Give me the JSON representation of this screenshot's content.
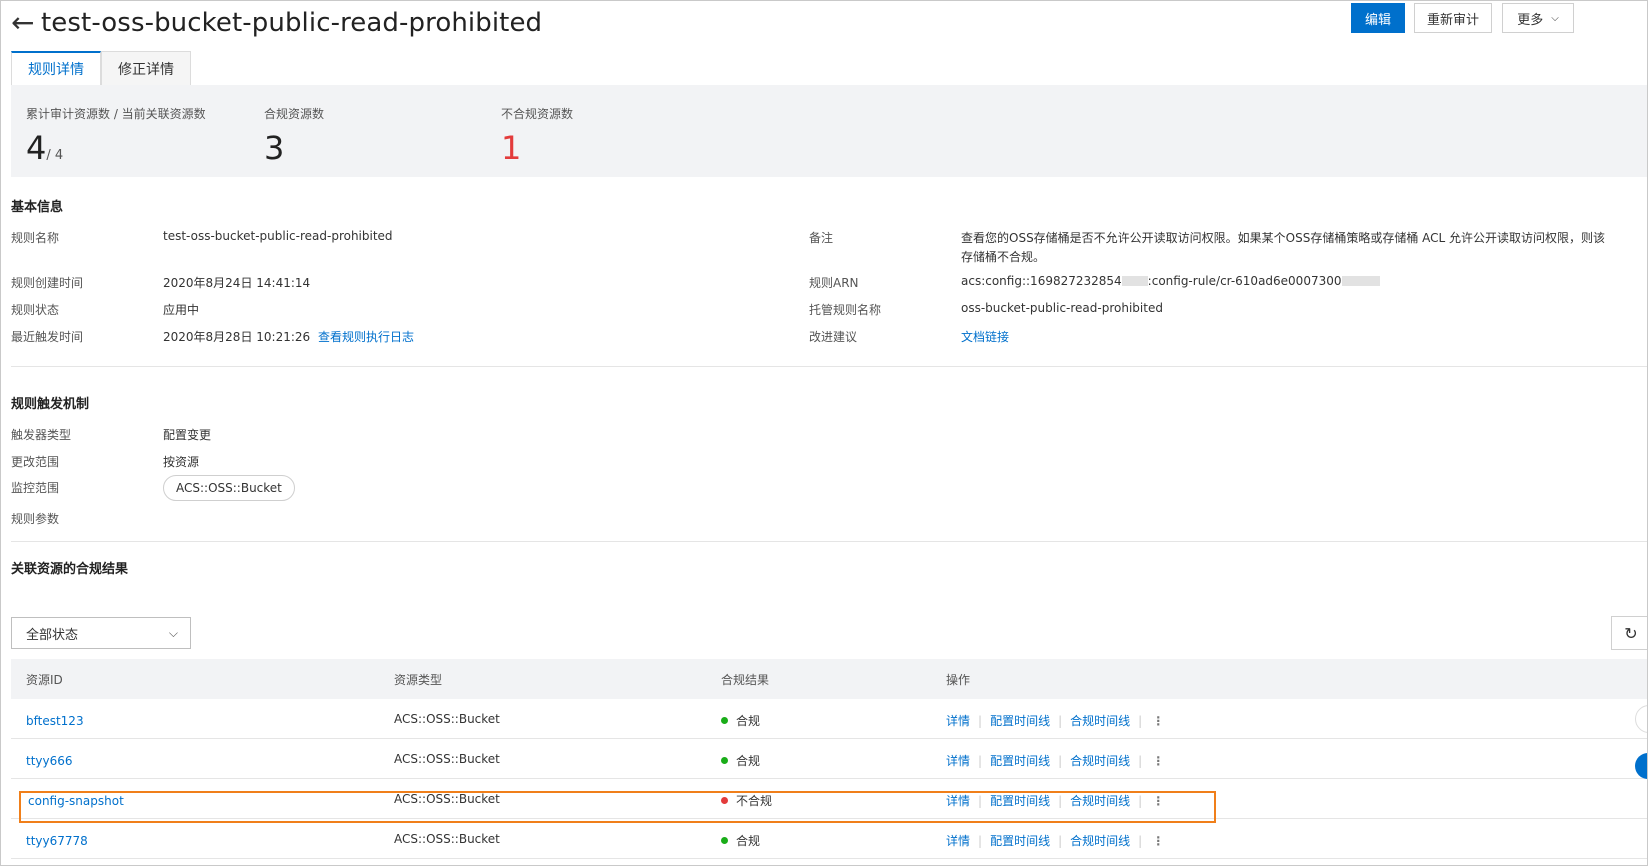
{
  "header": {
    "title": "test-oss-bucket-public-read-prohibited",
    "edit_label": "编辑",
    "reaudit_label": "重新审计",
    "more_label": "更多"
  },
  "tabs": [
    {
      "label": "规则详情"
    },
    {
      "label": "修正详情"
    }
  ],
  "stats": {
    "audited_label": "累计审计资源数 / 当前关联资源数",
    "audited_value": "4",
    "audited_total": "/ 4",
    "compliant_label": "合规资源数",
    "compliant_value": "3",
    "noncompliant_label": "不合规资源数",
    "noncompliant_value": "1"
  },
  "basic": {
    "section_title": "基本信息",
    "rule_name_label": "规则名称",
    "rule_name": "test-oss-bucket-public-read-prohibited",
    "created_label": "规则创建时间",
    "created": "2020年8月24日 14:41:14",
    "status_label": "规则状态",
    "status": "应用中",
    "last_trigger_label": "最近触发时间",
    "last_trigger": "2020年8月28日 10:21:26",
    "log_link": "查看规则执行日志",
    "note_label": "备注",
    "note_line1": "查看您的OSS存储桶是否不允许公开读取访问权限。如果某个OSS存储桶策略或存储桶 ACL 允许公开读取访问权限，则该",
    "note_line2": "存储桶不合规。",
    "arn_label": "规则ARN",
    "arn_part1": "acs:config::169827232854",
    "arn_part2": ":config-rule/cr-610ad6e0007300",
    "managed_label": "托管规则名称",
    "managed": "oss-bucket-public-read-prohibited",
    "suggest_label": "改进建议",
    "suggest_link": "文档链接"
  },
  "trigger": {
    "section_title": "规则触发机制",
    "type_label": "触发器类型",
    "type": "配置变更",
    "scope_label": "更改范围",
    "scope": "按资源",
    "monitor_label": "监控范围",
    "monitor": "ACS::OSS::Bucket",
    "params_label": "规则参数"
  },
  "results": {
    "section_title": "关联资源的合规结果",
    "filter_value": "全部状态",
    "columns": {
      "id": "资源ID",
      "type": "资源类型",
      "result": "合规结果",
      "ops": "操作"
    },
    "rows": [
      {
        "id": "bftest123",
        "type": "ACS::OSS::Bucket",
        "result": "合规"
      },
      {
        "id": "ttyy666",
        "type": "ACS::OSS::Bucket",
        "result": "合规"
      },
      {
        "id": "config-snapshot",
        "type": "ACS::OSS::Bucket",
        "result": "不合规"
      },
      {
        "id": "ttyy67778",
        "type": "ACS::OSS::Bucket",
        "result": "合规"
      }
    ],
    "op_detail": "详情",
    "op_config_timeline": "配置时间线",
    "op_compliance_timeline": "合规时间线"
  },
  "colors": {
    "primary": "#0070cc",
    "compliant": "#1aad19",
    "noncompliant": "#e33b3b",
    "highlight": "#f07f1a"
  }
}
